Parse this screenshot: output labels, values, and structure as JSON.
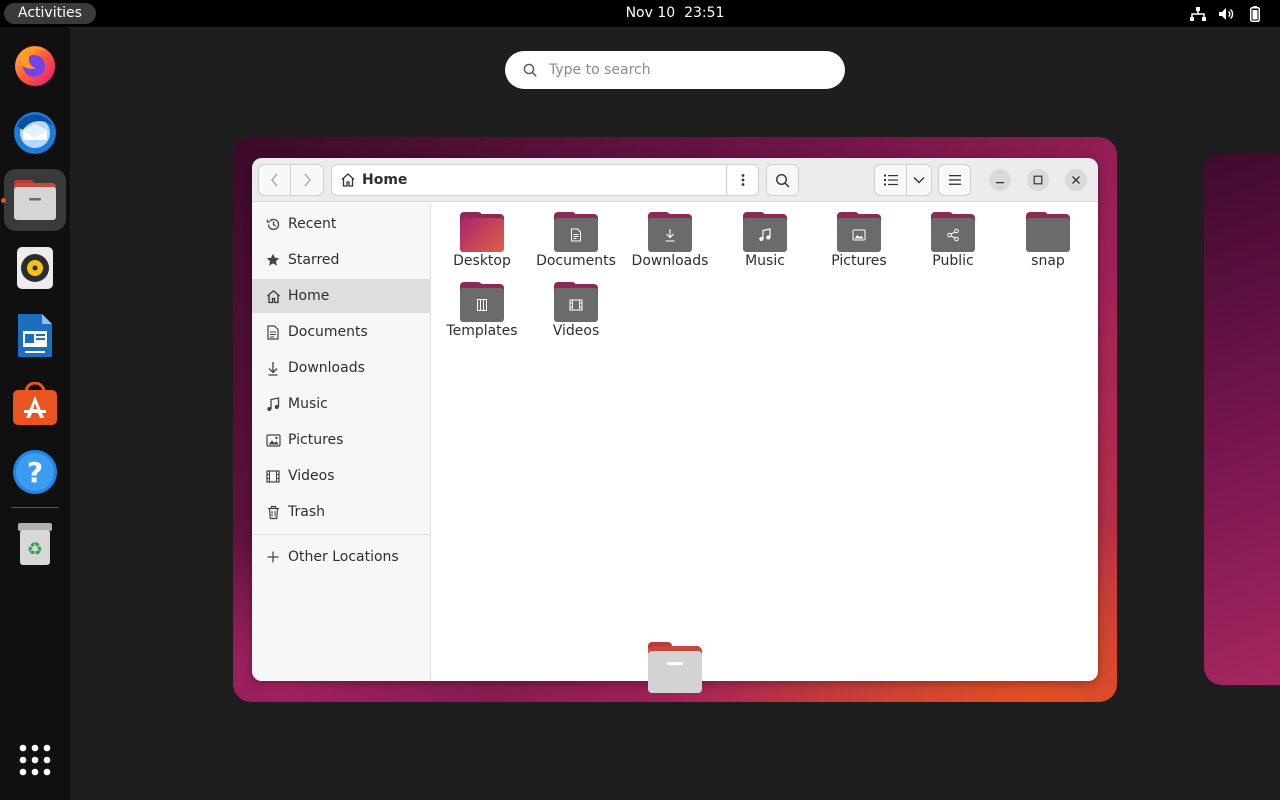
{
  "topbar": {
    "activities": "Activities",
    "date": "Nov 10",
    "time": "23:51",
    "tray_icons": [
      "network-icon",
      "volume-icon",
      "battery-icon"
    ]
  },
  "dock": {
    "apps": [
      {
        "name": "Firefox",
        "icon": "firefox-icon"
      },
      {
        "name": "Thunderbird",
        "icon": "thunderbird-icon"
      },
      {
        "name": "Files",
        "icon": "files-icon",
        "active": true
      },
      {
        "name": "Rhythmbox",
        "icon": "rhythmbox-icon"
      },
      {
        "name": "LibreOffice Writer",
        "icon": "writer-icon"
      },
      {
        "name": "Ubuntu Software",
        "icon": "software-icon"
      },
      {
        "name": "Help",
        "icon": "help-icon"
      },
      {
        "name": "Trash",
        "icon": "trash-icon"
      }
    ],
    "show_apps_icon": "app-grid-icon"
  },
  "search": {
    "placeholder": "Type to search"
  },
  "files_window": {
    "path": "Home",
    "sidebar": [
      {
        "label": "Recent",
        "icon": "clock-icon"
      },
      {
        "label": "Starred",
        "icon": "star-icon"
      },
      {
        "label": "Home",
        "icon": "home-icon",
        "selected": true
      },
      {
        "label": "Documents",
        "icon": "document-icon"
      },
      {
        "label": "Downloads",
        "icon": "download-icon"
      },
      {
        "label": "Music",
        "icon": "music-icon"
      },
      {
        "label": "Pictures",
        "icon": "picture-icon"
      },
      {
        "label": "Videos",
        "icon": "video-icon"
      },
      {
        "label": "Trash",
        "icon": "trash-icon"
      }
    ],
    "other_locations": "Other Locations",
    "folders": [
      {
        "label": "Desktop",
        "emblem": "desktop"
      },
      {
        "label": "Documents",
        "emblem": "document"
      },
      {
        "label": "Downloads",
        "emblem": "download"
      },
      {
        "label": "Music",
        "emblem": "music"
      },
      {
        "label": "Pictures",
        "emblem": "picture"
      },
      {
        "label": "Public",
        "emblem": "share"
      },
      {
        "label": "snap",
        "emblem": "none"
      },
      {
        "label": "Templates",
        "emblem": "template"
      },
      {
        "label": "Videos",
        "emblem": "video"
      }
    ]
  },
  "colors": {
    "accent": "#e95420",
    "folder_tab": "#8a2a55",
    "folder_body": "#6b6b6b"
  }
}
